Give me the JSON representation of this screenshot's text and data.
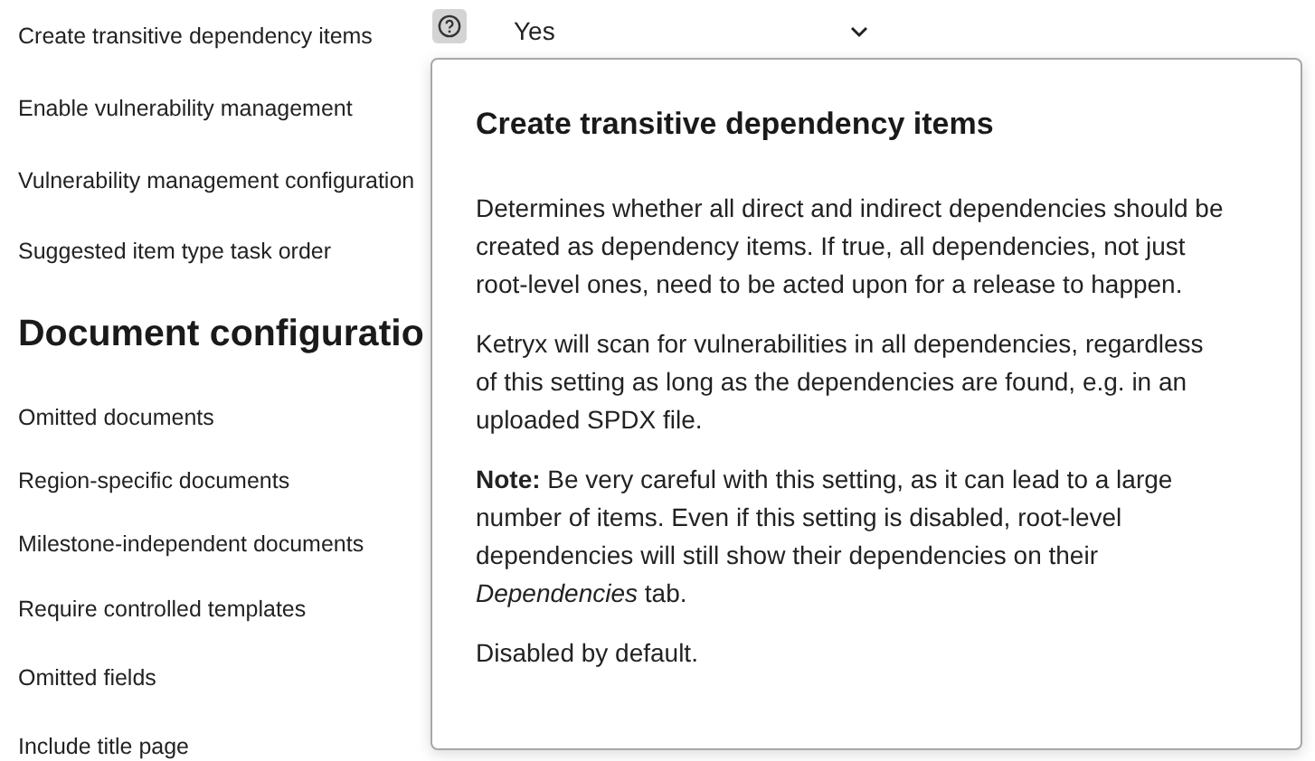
{
  "settings": [
    {
      "label": "Create transitive dependency items",
      "help": true,
      "value": "Yes"
    },
    {
      "label": "Enable vulnerability management",
      "help": false
    },
    {
      "label": "Vulnerability management configuration",
      "help": false
    },
    {
      "label": "Suggested item type task order",
      "help": false
    }
  ],
  "section": {
    "heading": "Document configuratio",
    "rows": [
      {
        "label": "Omitted documents"
      },
      {
        "label": "Region-specific documents"
      },
      {
        "label": "Milestone-independent documents"
      },
      {
        "label": "Require controlled templates"
      },
      {
        "label": "Omitted fields"
      },
      {
        "label": "Include title page"
      }
    ]
  },
  "popover": {
    "title": "Create transitive dependency items",
    "paragraphs": [
      "Determines whether all direct and indirect dependencies should be created as dependency items. If true, all dependencies, not just root-level ones, need to be acted upon for a release to happen.",
      "Ketryx will scan for vulnerabilities in all dependencies, regardless of this setting as long as the dependencies are found, e.g. in an uploaded SPDX file.",
      "**Note:** Be very careful with this setting, as it can lead to a large number of items. Even if this setting is disabled, root-level dependencies will still show their dependencies on their *Dependencies* tab.",
      "Disabled by default."
    ]
  }
}
